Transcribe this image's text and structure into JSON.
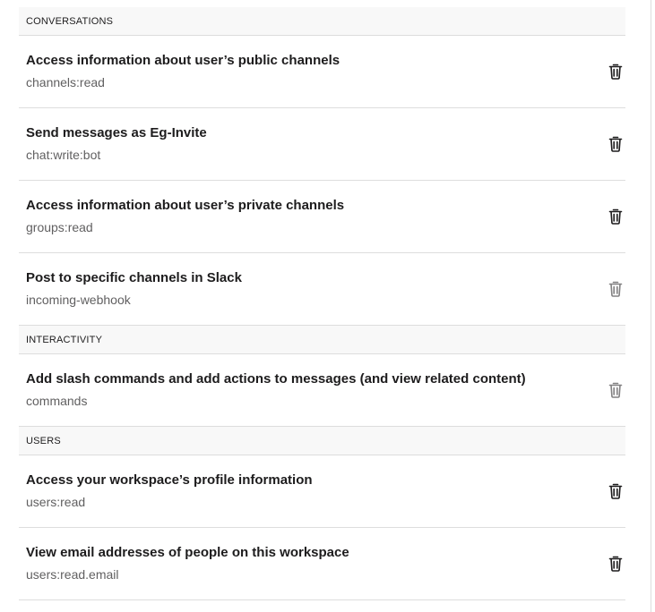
{
  "sections": [
    {
      "header": "CONVERSATIONS",
      "scopes": [
        {
          "title": "Access information about user’s public channels",
          "scope": "channels:read",
          "remove_icon": "trash-icon"
        },
        {
          "title": "Send messages as Eg-Invite",
          "scope": "chat:write:bot",
          "remove_icon": "trash-icon"
        },
        {
          "title": "Access information about user’s private channels",
          "scope": "groups:read",
          "remove_icon": "trash-icon"
        },
        {
          "title": "Post to specific channels in Slack",
          "scope": "incoming-webhook",
          "remove_icon": "trash-icon"
        }
      ]
    },
    {
      "header": "INTERACTIVITY",
      "scopes": [
        {
          "title": "Add slash commands and add actions to messages (and view related content)",
          "scope": "commands",
          "remove_icon": "trash-icon"
        }
      ]
    },
    {
      "header": "USERS",
      "scopes": [
        {
          "title": "Access your workspace’s profile information",
          "scope": "users:read",
          "remove_icon": "trash-icon"
        },
        {
          "title": "View email addresses of people on this workspace",
          "scope": "users:read.email",
          "remove_icon": "trash-icon"
        }
      ]
    }
  ],
  "colors": {
    "text": "#1d1c1d",
    "muted": "#616061",
    "header_bg": "#f8f8f8",
    "border": "#dddddd"
  }
}
